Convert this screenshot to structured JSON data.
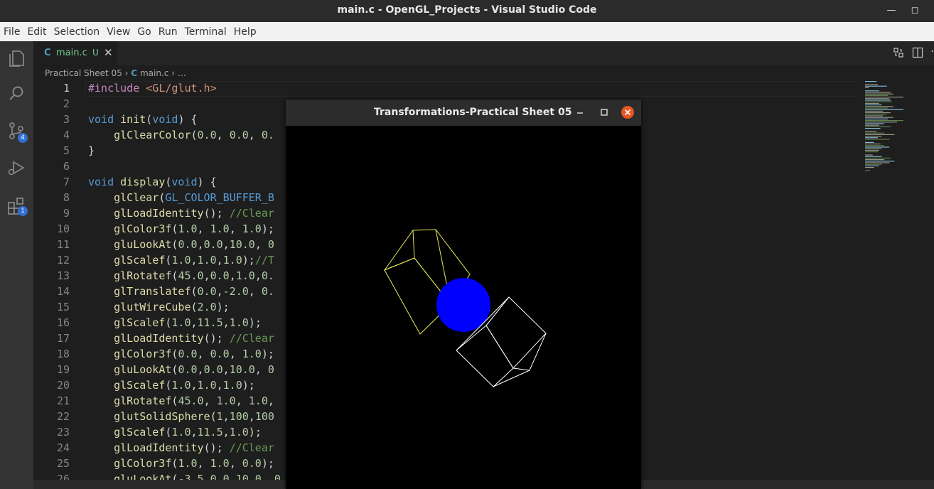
{
  "os_window": {
    "title": "main.c - OpenGL_Projects - Visual Studio Code"
  },
  "menu": [
    "File",
    "Edit",
    "Selection",
    "View",
    "Go",
    "Run",
    "Terminal",
    "Help"
  ],
  "activity": {
    "source_control_badge": "4",
    "extensions_badge": "1"
  },
  "tab": {
    "icon_label": "C",
    "name": "main.c",
    "status": "U"
  },
  "breadcrumb": {
    "folder": "Practical Sheet 05",
    "file_icon": "C",
    "file": "main.c",
    "more": "…"
  },
  "code_lines": [
    {
      "n": "1",
      "t": "#include <GL/glut.h>"
    },
    {
      "n": "2",
      "t": ""
    },
    {
      "n": "3",
      "t": "void init(void) {"
    },
    {
      "n": "4",
      "t": "    glClearColor(0.0, 0.0, 0."
    },
    {
      "n": "5",
      "t": "}"
    },
    {
      "n": "6",
      "t": ""
    },
    {
      "n": "7",
      "t": "void display(void) {"
    },
    {
      "n": "8",
      "t": "    glClear(GL_COLOR_BUFFER_B"
    },
    {
      "n": "9",
      "t": "    glLoadIdentity(); //Clear"
    },
    {
      "n": "10",
      "t": "    glColor3f(1.0, 1.0, 1.0);"
    },
    {
      "n": "11",
      "t": "    gluLookAt(0.0,0.0,10.0, 0"
    },
    {
      "n": "12",
      "t": "    glScalef(1.0,1.0,1.0);//T"
    },
    {
      "n": "13",
      "t": "    glRotatef(45.0,0.0,1.0,0."
    },
    {
      "n": "14",
      "t": "    glTranslatef(0.0,-2.0, 0."
    },
    {
      "n": "15",
      "t": "    glutWireCube(2.0);"
    },
    {
      "n": "16",
      "t": "    glScalef(1.0,11.5,1.0);"
    },
    {
      "n": "17",
      "t": "    glLoadIdentity(); //Clear"
    },
    {
      "n": "18",
      "t": "    glColor3f(0.0, 0.0, 1.0);"
    },
    {
      "n": "19",
      "t": "    gluLookAt(0.0,0.0,10.0, 0"
    },
    {
      "n": "20",
      "t": "    glScalef(1.0,1.0,1.0);"
    },
    {
      "n": "21",
      "t": "    glRotatef(45.0, 1.0, 1.0,"
    },
    {
      "n": "22",
      "t": "    glutSolidSphere(1,100,100"
    },
    {
      "n": "23",
      "t": "    glScalef(1.0,11.5,1.0);"
    },
    {
      "n": "24",
      "t": "    glLoadIdentity(); //Clear"
    },
    {
      "n": "25",
      "t": "    glColor3f(1.0, 1.0, 0.0);"
    },
    {
      "n": "26",
      "t": "    gluLookAt(-3.5,0.0,10.0, 0"
    }
  ],
  "gl_window": {
    "title": "Transformations-Practical Sheet 05"
  },
  "colors": {
    "keyword": "#569cd6",
    "function": "#dcdcaa",
    "number": "#b5cea8",
    "string": "#ce9178",
    "comment": "#6a9955",
    "include": "#c586c0",
    "constant": "#4fc1ff",
    "text": "#d4d4d4"
  }
}
